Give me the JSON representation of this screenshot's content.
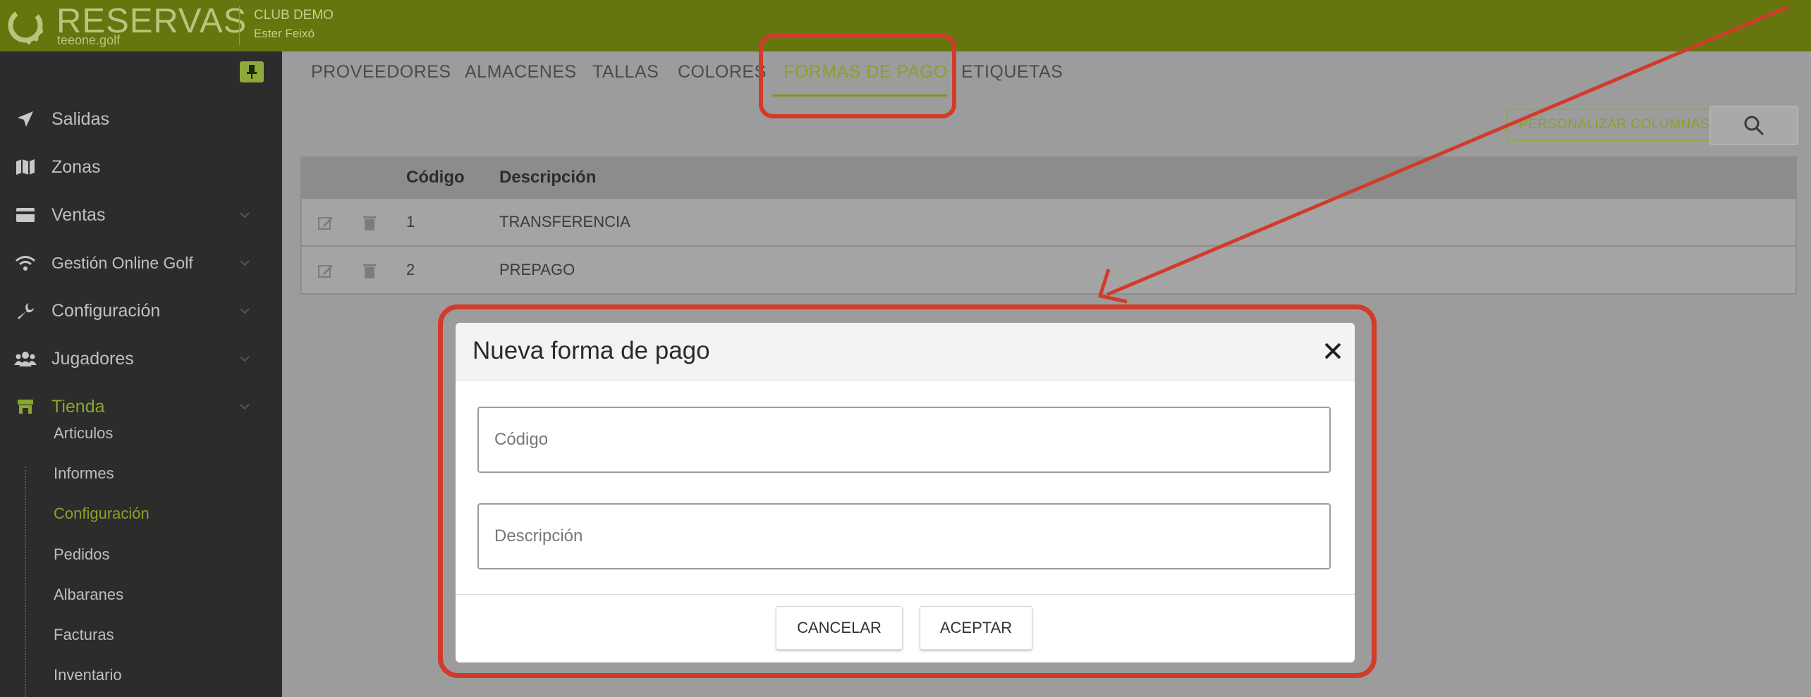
{
  "header": {
    "brand": "RESERVAS",
    "brand_sub": "teeone.golf",
    "club": "CLUB DEMO",
    "user": "Ester Feixó"
  },
  "sidebar": {
    "items": [
      {
        "label": "Salidas",
        "icon": "paper-plane-icon"
      },
      {
        "label": "Zonas",
        "icon": "map-icon"
      },
      {
        "label": "Ventas",
        "icon": "credit-card-icon"
      },
      {
        "label": "Gestión Online Golf",
        "icon": "wifi-icon"
      },
      {
        "label": "Configuración",
        "icon": "wrench-icon"
      },
      {
        "label": "Jugadores",
        "icon": "users-icon"
      },
      {
        "label": "Tienda",
        "icon": "store-icon"
      }
    ],
    "subitems": [
      "Articulos",
      "Informes",
      "Configuración",
      "Pedidos",
      "Albaranes",
      "Facturas",
      "Inventario"
    ],
    "active_item": "Tienda",
    "active_subitem": "Configuración"
  },
  "tabs": [
    "PROVEEDORES",
    "ALMACENES",
    "TALLAS",
    "COLORES",
    "FORMAS DE PAGO",
    "ETIQUETAS"
  ],
  "active_tab": "FORMAS DE PAGO",
  "toolbar": {
    "columns_label": "PERSONALIZAR COLUMNAS"
  },
  "table": {
    "headers": [
      "Código",
      "Descripción"
    ],
    "rows": [
      {
        "codigo": "1",
        "descripcion": "TRANSFERENCIA"
      },
      {
        "codigo": "2",
        "descripcion": "PREPAGO"
      }
    ]
  },
  "modal": {
    "title": "Nueva forma de pago",
    "codigo_placeholder": "Código",
    "descripcion_placeholder": "Descripción",
    "cancel_label": "CANCELAR",
    "accept_label": "ACEPTAR"
  },
  "colors": {
    "header_bg": "#67750f",
    "accent": "#89a12c",
    "annotation": "#d23b2a"
  }
}
